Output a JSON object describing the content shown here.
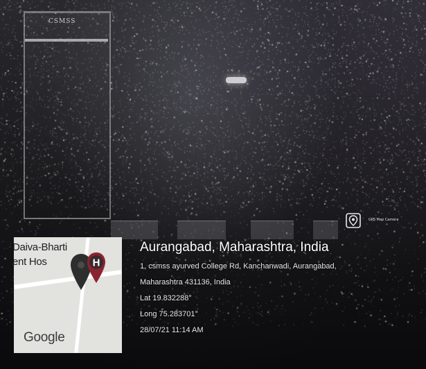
{
  "background": {
    "sign_text": "CSMSS",
    "palette": {
      "base": "#161618",
      "grain": "#d8d8d8"
    }
  },
  "overlay": {
    "app_logo_icon": "gps-map-camera-icon",
    "app_name": "GPS Map Camera",
    "map": {
      "labels": [
        "Daiva-Bharti",
        "ent Hos"
      ],
      "pin_icon": "map-pin-icon",
      "hospital_marker_icon": "hospital-marker-icon",
      "hospital_marker_letter": "H",
      "provider_logo": "Google",
      "colors": {
        "land": "#e2e2df",
        "pin": "#2e2e2e",
        "hospital_marker": "#8b2430"
      }
    },
    "location": {
      "title": "Aurangabad, Maharashtra, India",
      "address_line1": "1, csmss ayurved College Rd, Kanchanwadi, Aurangabad,",
      "address_line2": "Maharashtra 431136, India",
      "latitude": "Lat 19.832288°",
      "longitude": "Long 75.283701°",
      "timestamp": "28/07/21 11:14 AM"
    }
  }
}
